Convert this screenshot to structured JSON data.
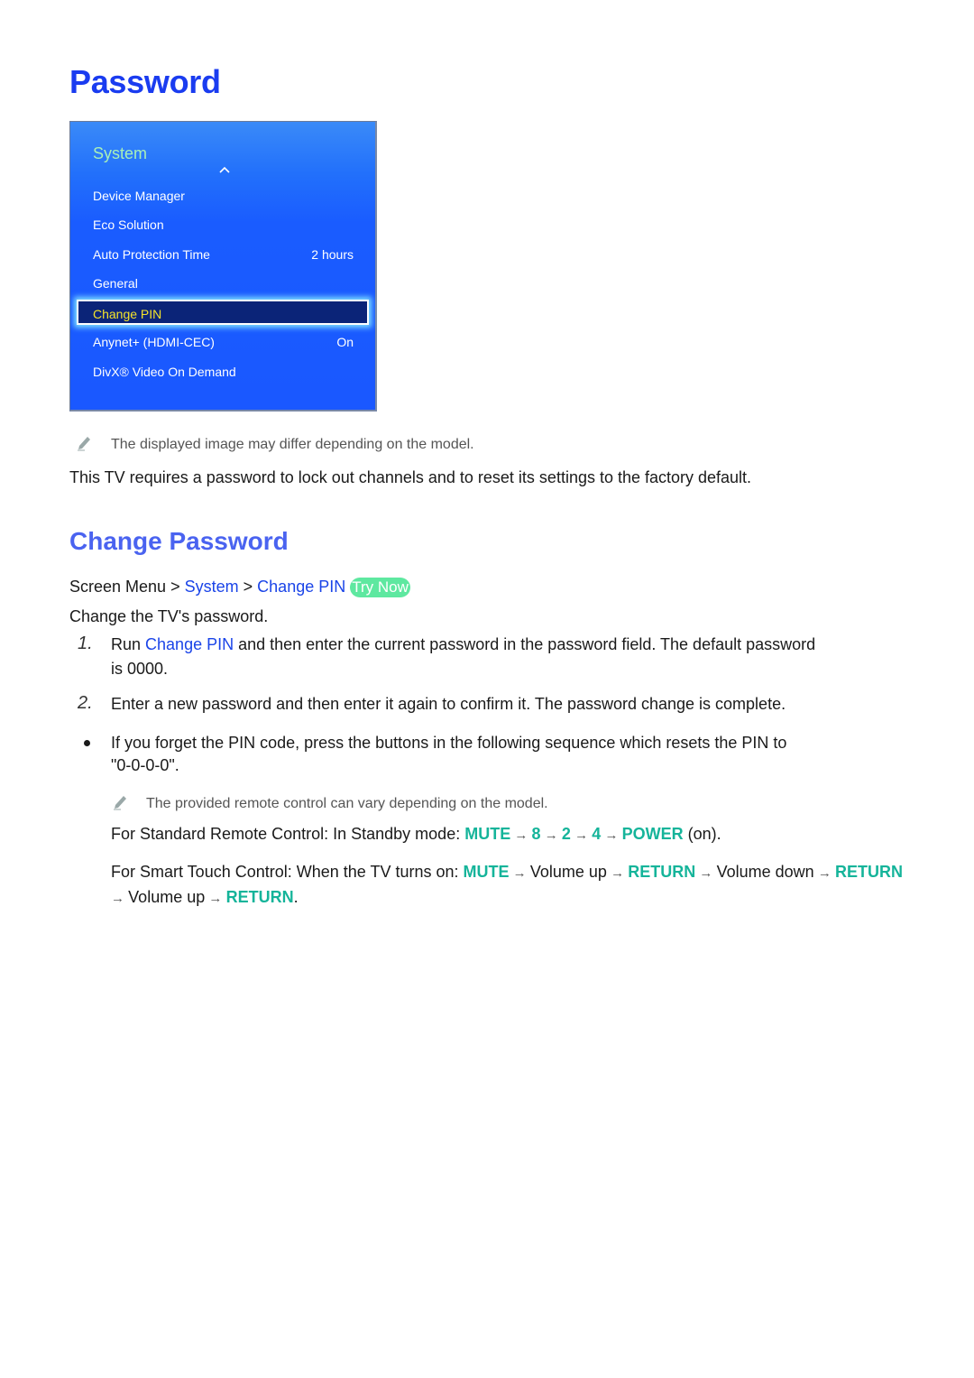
{
  "page": {
    "title": "Password"
  },
  "tv_menu": {
    "title": "System",
    "scroll_icon": "chevron-up-icon",
    "items": [
      {
        "label": "Device Manager",
        "value": ""
      },
      {
        "label": "Eco Solution",
        "value": ""
      },
      {
        "label": "Auto Protection Time",
        "value": "2 hours"
      },
      {
        "label": "General",
        "value": ""
      },
      {
        "label": "Change PIN",
        "value": "",
        "selected": true
      },
      {
        "label": "Anynet+ (HDMI-CEC)",
        "value": "On"
      },
      {
        "label": "DivX® Video On Demand",
        "value": ""
      }
    ]
  },
  "notes": {
    "image_note": "The displayed image may differ depending on the model.",
    "remote_note": "The provided remote control can vary depending on the model."
  },
  "intro": "This TV requires a password to lock out channels and to reset its settings to the factory default.",
  "section": {
    "title": "Change Password",
    "breadcrumb": {
      "root": "Screen Menu",
      "sep": ">",
      "level1": "System",
      "level2": "Change PIN",
      "try_now": "Try Now"
    },
    "description": "Change the TV's password.",
    "steps": [
      {
        "number": "1.",
        "pre": "Run ",
        "link": "Change PIN",
        "post": " and then enter the current password in the password field. The default password",
        "line2": "is 0000."
      },
      {
        "number": "2.",
        "text": "Enter a new password and then enter it again to confirm it. The password change is complete."
      }
    ],
    "bullet": {
      "line1": "If you forget the PIN code, press the buttons in the following sequence which resets the PIN to",
      "line2": "\"0-0-0-0\"."
    },
    "standard_remote": {
      "prefix": "For Standard Remote Control: In Standby mode: ",
      "keys": [
        "MUTE",
        "8",
        "2",
        "4",
        "POWER"
      ],
      "suffix": " (on)."
    },
    "smart_touch": {
      "prefix": "For Smart Touch Control: When the TV turns on: ",
      "seq": [
        {
          "t": "MUTE",
          "k": true
        },
        {
          "t": "Volume up",
          "k": false
        },
        {
          "t": "RETURN",
          "k": true
        },
        {
          "t": "Volume down",
          "k": false
        },
        {
          "t": "RETURN",
          "k": true
        },
        {
          "t": "Volume up",
          "k": false
        },
        {
          "t": "RETURN",
          "k": true
        }
      ],
      "end": "."
    },
    "arrow": "→"
  }
}
